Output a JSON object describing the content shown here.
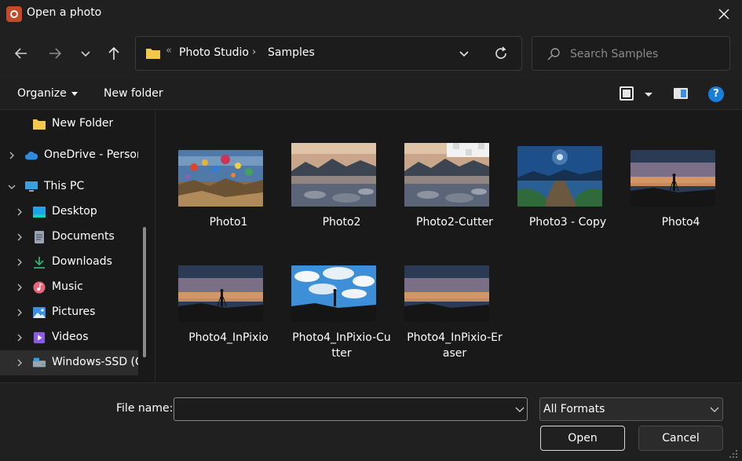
{
  "window": {
    "title": "Open a photo"
  },
  "navigation": {
    "back_icon": "arrow-left-icon",
    "forward_icon": "arrow-right-icon",
    "recent_icon": "chevron-down-icon",
    "up_icon": "arrow-up-icon"
  },
  "address": {
    "overflow": "«",
    "crumbs": [
      "Photo Studio",
      "Samples"
    ],
    "separator": "›"
  },
  "search": {
    "placeholder": "Search Samples"
  },
  "toolbar": {
    "organize_label": "Organize",
    "new_folder_label": "New folder",
    "help_label": "?"
  },
  "sidebar": {
    "items": [
      {
        "label": "New Folder",
        "icon": "folder-icon",
        "color": "#f2c94c"
      },
      {
        "label": "OneDrive - Person",
        "icon": "cloud-icon",
        "color": "#2b8ce0"
      },
      {
        "label": "This PC",
        "icon": "computer-icon",
        "color": "#3aa0e0"
      },
      {
        "label": "Desktop",
        "icon": "desktop-icon",
        "color": "#1fa3e8"
      },
      {
        "label": "Documents",
        "icon": "documents-icon",
        "color": "#9aa4b2"
      },
      {
        "label": "Downloads",
        "icon": "download-icon",
        "color": "#2bb673"
      },
      {
        "label": "Music",
        "icon": "music-icon",
        "color": "#e8657a"
      },
      {
        "label": "Pictures",
        "icon": "pictures-icon",
        "color": "#3a8ee6"
      },
      {
        "label": "Videos",
        "icon": "videos-icon",
        "color": "#8a5ce6"
      },
      {
        "label": "Windows-SSD (C",
        "icon": "drive-icon",
        "color": "#9aa4b2"
      }
    ]
  },
  "files": [
    {
      "label": "Photo1",
      "scene": "balloons"
    },
    {
      "label": "Photo2",
      "scene": "lake"
    },
    {
      "label": "Photo2-Cutter",
      "scene": "lake-cut"
    },
    {
      "label": "Photo3 - Copy",
      "scene": "pier"
    },
    {
      "label": "Photo4",
      "scene": "sunset"
    },
    {
      "label": "Photo4_InPixio",
      "scene": "sunset"
    },
    {
      "label": "Photo4_InPixio-Cutter",
      "scene": "sky-blue"
    },
    {
      "label": "Photo4_InPixio-Eraser",
      "scene": "sunset"
    }
  ],
  "footer": {
    "filename_label": "File name:",
    "filename_value": "",
    "format_value": "All Formats",
    "open_label": "Open",
    "cancel_label": "Cancel"
  },
  "colors": {
    "accent": "#1a7fd8",
    "background": "#191919",
    "chrome": "#202020"
  }
}
